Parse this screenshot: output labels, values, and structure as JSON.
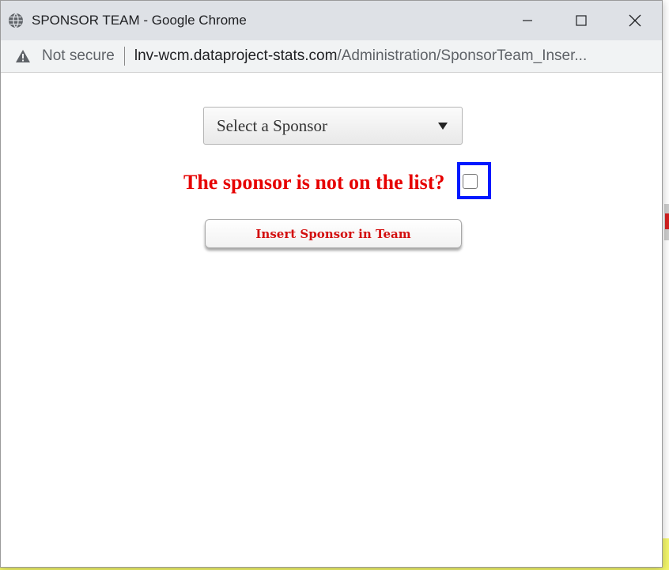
{
  "window": {
    "title": "SPONSOR TEAM - Google Chrome"
  },
  "address_bar": {
    "security_label": "Not secure",
    "url_host": "lnv-wcm.dataproject-stats.com",
    "url_path": "/Administration/SponsorTeam_Inser..."
  },
  "form": {
    "sponsor_select": {
      "selected": "Select a Sponsor",
      "options": [
        "Select a Sponsor"
      ]
    },
    "not_on_list_label": "The sponsor is not on the list?",
    "not_on_list_checked": false,
    "insert_button_label": "Insert Sponsor in Team"
  },
  "colors": {
    "label_red": "#e60000",
    "button_text_red": "#d30f0f",
    "highlight_blue": "#0019ff",
    "titlebar_bg": "#dee1e6"
  },
  "icons": [
    "globe-icon",
    "minimize-icon",
    "maximize-icon",
    "close-icon",
    "warning-icon",
    "dropdown-caret-icon",
    "checkbox"
  ]
}
